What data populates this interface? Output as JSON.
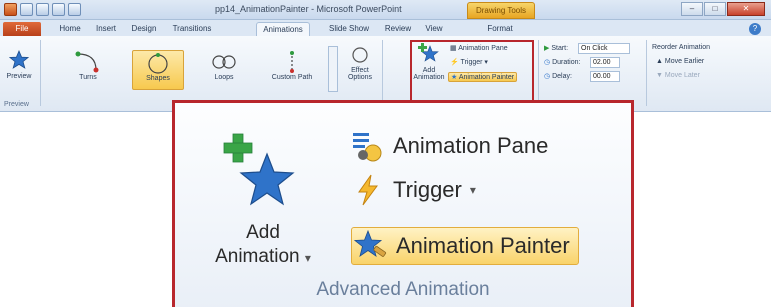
{
  "window": {
    "title": "pp14_AnimationPainter - Microsoft PowerPoint",
    "contextual_tab": "Drawing Tools"
  },
  "tabs": [
    {
      "label": "File"
    },
    {
      "label": "Home"
    },
    {
      "label": "Insert"
    },
    {
      "label": "Design"
    },
    {
      "label": "Transitions"
    },
    {
      "label": "Animations"
    },
    {
      "label": "Slide Show"
    },
    {
      "label": "Review"
    },
    {
      "label": "View"
    },
    {
      "label": "Format"
    }
  ],
  "ribbon": {
    "preview": {
      "label": "Preview",
      "group_label": "Preview"
    },
    "gallery": [
      {
        "label": "Turns"
      },
      {
        "label": "Shapes"
      },
      {
        "label": "Loops"
      },
      {
        "label": "Custom Path"
      }
    ],
    "effect_options": "Effect Options",
    "add_animation": "Add Animation",
    "animation_pane": "Animation Pane",
    "trigger": "Trigger",
    "animation_painter": "Animation Painter",
    "timing": {
      "start_label": "Start:",
      "start_value": "On Click",
      "duration_label": "Duration:",
      "duration_value": "02.00",
      "delay_label": "Delay:",
      "delay_value": "00.00"
    },
    "reorder": {
      "title": "Reorder Animation",
      "earlier": "Move Earlier",
      "later": "Move Later"
    }
  },
  "zoom": {
    "add_line1": "Add",
    "add_line2": "Animation",
    "animation_pane": "Animation Pane",
    "trigger": "Trigger",
    "animation_painter": "Animation Painter",
    "group_label": "Advanced Animation"
  },
  "colors": {
    "highlight_outline": "#b8272d",
    "selected_fill": "#f9d36a",
    "file_tab": "#c8501a"
  }
}
